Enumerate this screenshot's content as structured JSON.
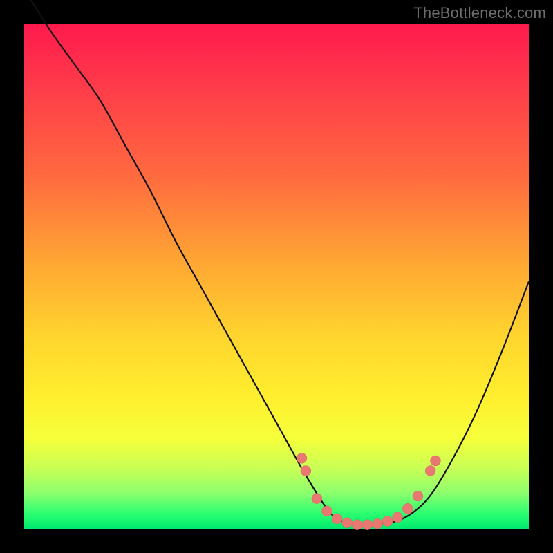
{
  "watermark": "TheBottleneck.com",
  "colors": {
    "background": "#000000",
    "gradient_top": "#ff1a4d",
    "gradient_bottom": "#00e86e",
    "curve": "#111111",
    "dots": "#e87871"
  },
  "chart_data": {
    "type": "line",
    "title": "",
    "xlabel": "",
    "ylabel": "",
    "xlim": [
      0,
      100
    ],
    "ylim": [
      0,
      100
    ],
    "curve": {
      "x": [
        0,
        5,
        10,
        15,
        20,
        25,
        30,
        35,
        40,
        45,
        50,
        55,
        58,
        60,
        62,
        65,
        70,
        75,
        80,
        85,
        90,
        95,
        100
      ],
      "y": [
        107,
        99,
        92,
        85,
        76,
        67,
        57,
        48,
        39,
        30,
        21,
        12,
        7,
        4,
        2,
        1,
        1,
        2,
        6,
        14,
        24,
        36,
        49
      ]
    },
    "dots": [
      {
        "x": 55.0,
        "y": 14.0
      },
      {
        "x": 55.8,
        "y": 11.5
      },
      {
        "x": 58.0,
        "y": 6.0
      },
      {
        "x": 60.0,
        "y": 3.5
      },
      {
        "x": 62.0,
        "y": 2.0
      },
      {
        "x": 64.0,
        "y": 1.2
      },
      {
        "x": 66.0,
        "y": 0.8
      },
      {
        "x": 68.0,
        "y": 0.8
      },
      {
        "x": 70.0,
        "y": 1.0
      },
      {
        "x": 72.0,
        "y": 1.5
      },
      {
        "x": 74.0,
        "y": 2.3
      },
      {
        "x": 76.0,
        "y": 4.0
      },
      {
        "x": 78.0,
        "y": 6.5
      },
      {
        "x": 80.5,
        "y": 11.5
      },
      {
        "x": 81.5,
        "y": 13.5
      }
    ],
    "dot_radius_px": 7.5
  }
}
